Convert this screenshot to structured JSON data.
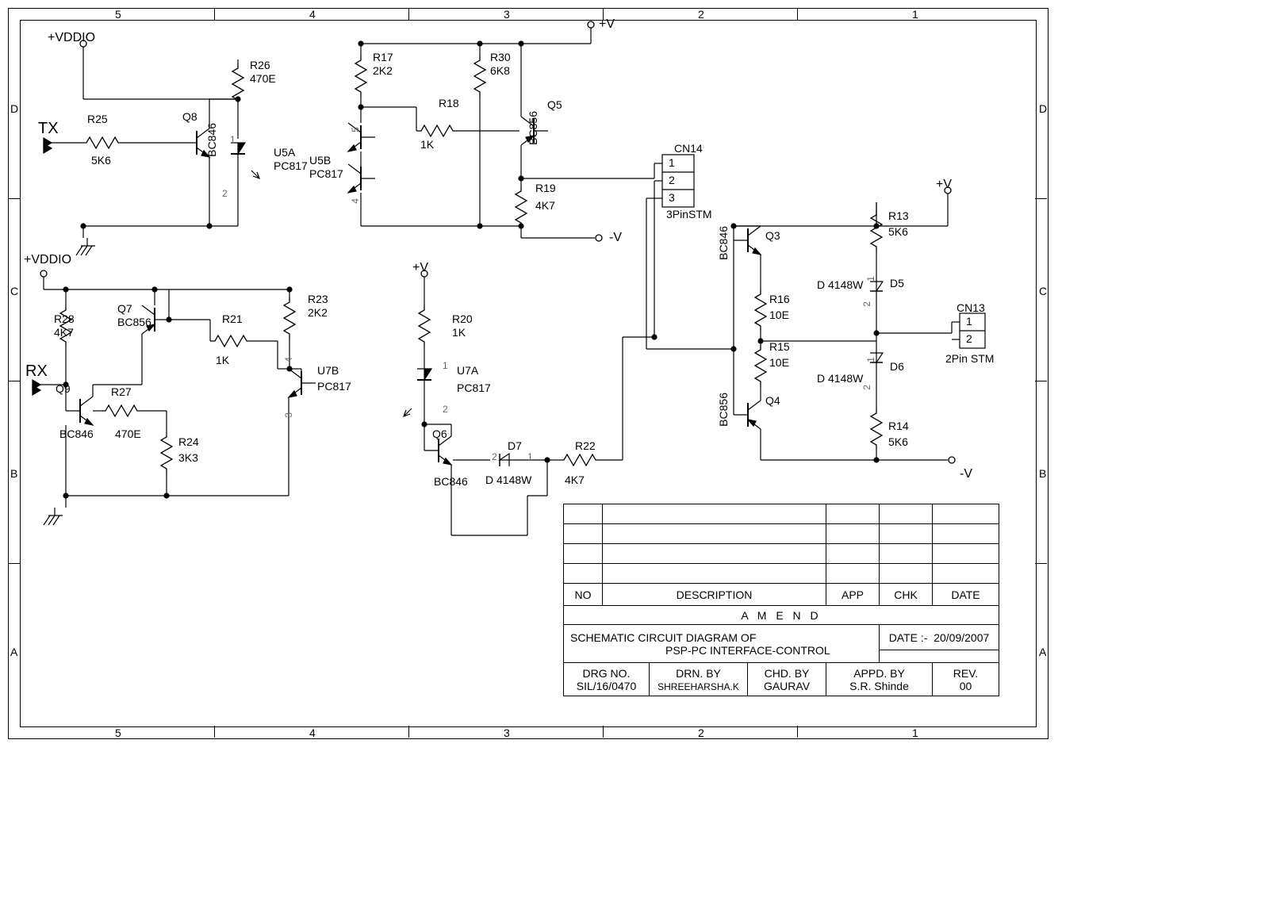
{
  "border": {
    "cols_top": [
      "5",
      "4",
      "3",
      "2",
      "1"
    ],
    "cols_bottom": [
      "5",
      "4",
      "3",
      "2",
      "1"
    ],
    "rows_left": [
      "D",
      "C",
      "B",
      "A"
    ],
    "rows_right": [
      "D",
      "C",
      "B",
      "A"
    ]
  },
  "rails": {
    "vddio_top": "+VDDIO",
    "vddio_left": "+VDDIO",
    "plus_v_a": "+V",
    "plus_v_b": "+V",
    "plus_v_c": "+V",
    "minus_v_a": "-V",
    "minus_v_b": "-V"
  },
  "signals": {
    "tx": "TX",
    "rx": "RX"
  },
  "components": {
    "R25": {
      "ref": "R25",
      "val": "5K6"
    },
    "R26": {
      "ref": "R26",
      "val": "470E"
    },
    "R17": {
      "ref": "R17",
      "val": "2K2"
    },
    "R30": {
      "ref": "R30",
      "val": "6K8"
    },
    "R18": {
      "ref": "R18",
      "val": "1K"
    },
    "R19": {
      "ref": "R19",
      "val": "4K7"
    },
    "R28": {
      "ref": "R28",
      "val": "4K7"
    },
    "R21": {
      "ref": "R21",
      "val": "1K"
    },
    "R23": {
      "ref": "R23",
      "val": "2K2"
    },
    "R27": {
      "ref": "R27",
      "val": "470E"
    },
    "R24": {
      "ref": "R24",
      "val": "3K3"
    },
    "R20": {
      "ref": "R20",
      "val": "1K"
    },
    "R22": {
      "ref": "R22",
      "val": "4K7"
    },
    "R13": {
      "ref": "R13",
      "val": "5K6"
    },
    "R16": {
      "ref": "R16",
      "val": "10E"
    },
    "R15": {
      "ref": "R15",
      "val": "10E"
    },
    "R14": {
      "ref": "R14",
      "val": "5K6"
    },
    "Q8": {
      "ref": "Q8",
      "type": "BC846"
    },
    "Q5": {
      "ref": "Q5",
      "type": "BC856"
    },
    "Q7": {
      "ref": "Q7",
      "type": "BC856"
    },
    "Q9": {
      "ref": "Q9",
      "type": "BC846"
    },
    "Q6": {
      "ref": "Q6",
      "type": "BC846"
    },
    "Q3": {
      "ref": "Q3",
      "type": "BC846"
    },
    "Q4": {
      "ref": "Q4",
      "type": "BC856"
    },
    "U5A": {
      "ref": "U5A",
      "type": "PC817"
    },
    "U5B": {
      "ref": "U5B",
      "type": "PC817"
    },
    "U7A": {
      "ref": "U7A",
      "type": "PC817"
    },
    "U7B": {
      "ref": "U7B",
      "type": "PC817"
    },
    "D5": {
      "ref": "D5",
      "type": "D 4148W"
    },
    "D6": {
      "ref": "D6",
      "type": "D 4148W"
    },
    "D7": {
      "ref": "D7",
      "type": "D 4148W"
    },
    "CN14": {
      "ref": "CN14",
      "pins": [
        "1",
        "2",
        "3"
      ],
      "type": "3PinSTM"
    },
    "CN13": {
      "ref": "CN13",
      "pins": [
        "1",
        "2"
      ],
      "type": "2Pin STM"
    }
  },
  "pins": {
    "p1": "1",
    "p2": "2",
    "p3": "3",
    "p4": "4",
    "p5": "5"
  },
  "titleblock": {
    "hdr_no": "NO",
    "hdr_desc": "DESCRIPTION",
    "hdr_app": "APP",
    "hdr_chk": "CHK",
    "hdr_date": "DATE",
    "amend": "A M E N D",
    "date_lbl": "DATE :-",
    "date_val": "20/09/2007",
    "title1": "SCHEMATIC CIRCUIT DIAGRAM OF",
    "title2": "PSP-PC INTERFACE-CONTROL",
    "drg_lbl": "DRG NO.",
    "drg_val": "SIL/16/0470",
    "drn_lbl": "DRN. BY",
    "drn_val": "SHREEHARSHA.K",
    "chd_lbl": "CHD. BY",
    "chd_val": "GAURAV",
    "appd_lbl": "APPD. BY",
    "appd_val": "S.R. Shinde",
    "rev_lbl": "REV.",
    "rev_val": "00"
  }
}
